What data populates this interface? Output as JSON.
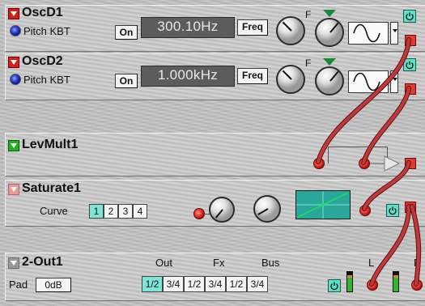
{
  "modules": {
    "oscd1": {
      "title": "OscD1",
      "pitch_label": "Pitch KBT",
      "kbt_button": "On",
      "freq_display": "300.10Hz",
      "freq_mode_button": "Freq",
      "fine_label": "F"
    },
    "oscd2": {
      "title": "OscD2",
      "pitch_label": "Pitch KBT",
      "kbt_button": "On",
      "freq_display": "1.000kHz",
      "freq_mode_button": "Freq",
      "fine_label": "F"
    },
    "levmult1": {
      "title": "LevMult1"
    },
    "saturate1": {
      "title": "Saturate1",
      "curve_label": "Curve",
      "curve_options": [
        "1",
        "2",
        "3",
        "4"
      ],
      "curve_selected": "1"
    },
    "out1": {
      "title": "2-Out1",
      "pad_label": "Pad",
      "pad_value": "0dB",
      "dest_headers": [
        "Out",
        "Fx",
        "Bus"
      ],
      "dest_options": [
        "1/2",
        "3/4",
        "1/2",
        "3/4",
        "1/2",
        "3/4"
      ],
      "dest_selected": "Out 1/2",
      "channel_left": "L",
      "channel_right": "R"
    }
  },
  "colors": {
    "cable": "#c0393b",
    "power_on": "#5ee0c8",
    "lcd_bg": "#5c5c5c",
    "port_out": "#e23a2e"
  }
}
